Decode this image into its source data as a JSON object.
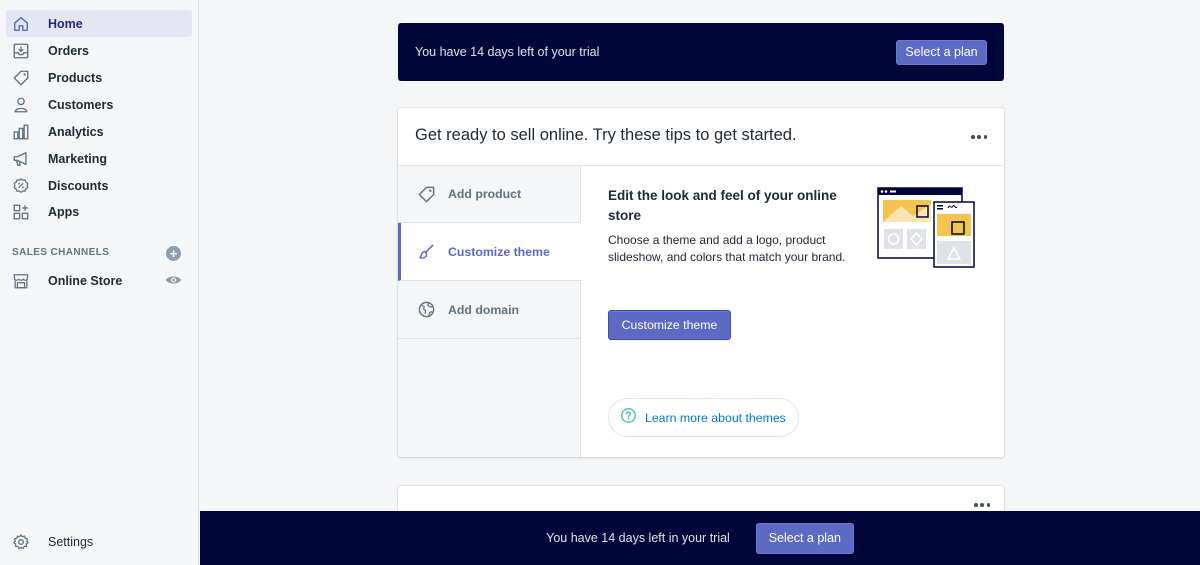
{
  "sidebar": {
    "items": [
      {
        "label": "Home",
        "icon": "home-icon",
        "active": true
      },
      {
        "label": "Orders",
        "icon": "orders-icon"
      },
      {
        "label": "Products",
        "icon": "tag-icon"
      },
      {
        "label": "Customers",
        "icon": "person-icon"
      },
      {
        "label": "Analytics",
        "icon": "bar-chart-icon"
      },
      {
        "label": "Marketing",
        "icon": "megaphone-icon"
      },
      {
        "label": "Discounts",
        "icon": "discount-icon"
      },
      {
        "label": "Apps",
        "icon": "apps-icon"
      }
    ],
    "channels_header": "SALES CHANNELS",
    "channels": [
      {
        "label": "Online Store",
        "icon": "store-icon"
      }
    ],
    "settings_label": "Settings"
  },
  "trial_banner": {
    "text": "You have 14 days left of your trial",
    "button": "Select a plan"
  },
  "tips_card": {
    "title": "Get ready to sell online. Try these tips to get started.",
    "tabs": [
      {
        "label": "Add product",
        "icon": "tag-icon"
      },
      {
        "label": "Customize theme",
        "icon": "brush-icon",
        "active": true
      },
      {
        "label": "Add domain",
        "icon": "globe-icon"
      }
    ],
    "panel": {
      "title": "Edit the look and feel of your online store",
      "description": "Choose a theme and add a logo, product slideshow, and colors that match your brand.",
      "button": "Customize theme",
      "learn_more": "Learn more about themes"
    }
  },
  "bottom_bar": {
    "text": "You have 14 days left in your trial",
    "button": "Select a plan"
  },
  "colors": {
    "accent": "#5c6ac4",
    "banner_bg": "#000639",
    "link": "#007ace"
  }
}
